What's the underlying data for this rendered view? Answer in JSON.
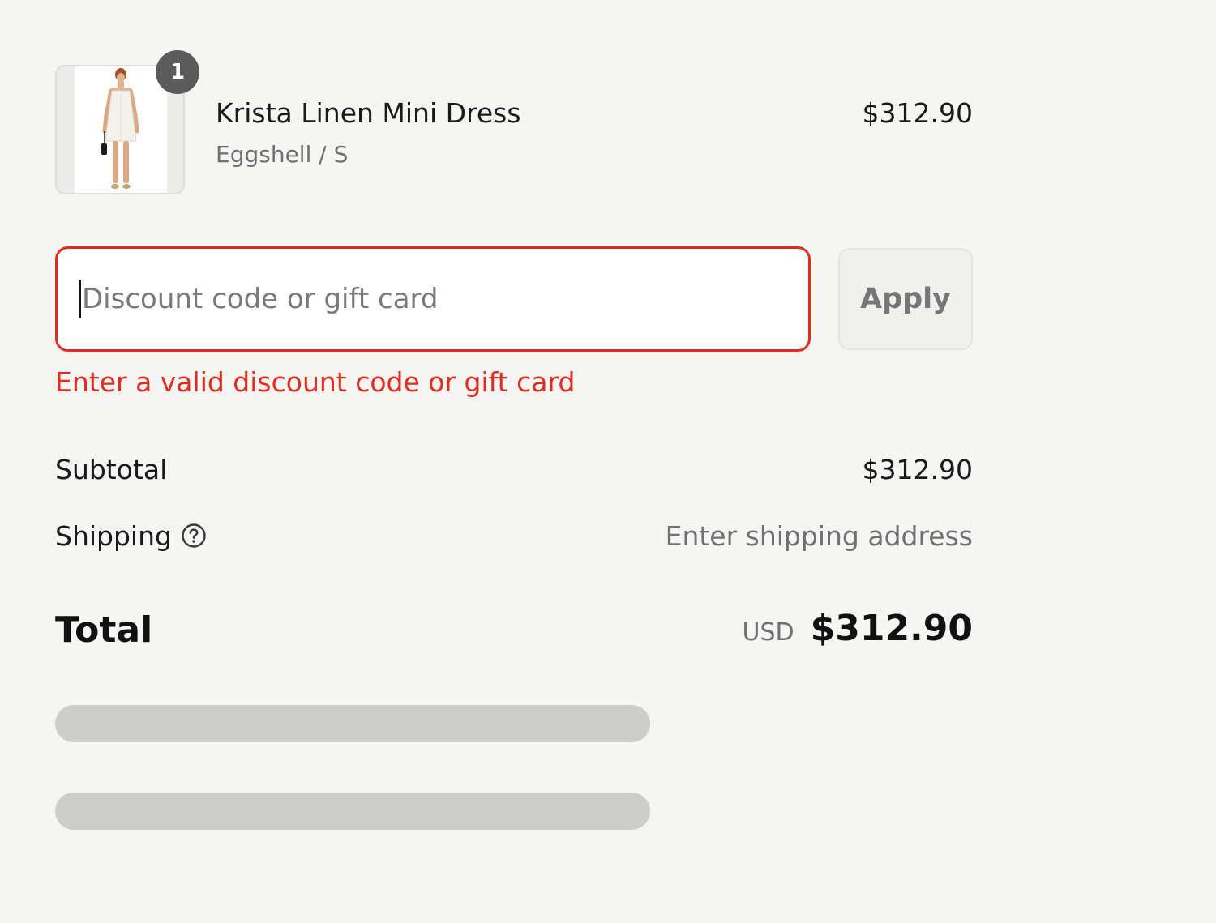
{
  "product": {
    "quantity": "1",
    "name": "Krista Linen Mini Dress",
    "variant": "Eggshell / S",
    "price": "$312.90",
    "image_icon": "dress-product-photo"
  },
  "discount": {
    "placeholder": "Discount code or gift card",
    "value": "",
    "apply_label": "Apply",
    "error": "Enter a valid discount code or gift card"
  },
  "totals": {
    "subtotal_label": "Subtotal",
    "subtotal_value": "$312.90",
    "shipping_label": "Shipping",
    "shipping_help_icon": "question-circle-icon",
    "shipping_value": "Enter shipping address",
    "total_label": "Total",
    "currency": "USD",
    "total_value": "$312.90"
  },
  "colors": {
    "error": "#e32c1e",
    "background": "#f5f5f3",
    "badge": "#5b5b5b",
    "skeleton": "#cdcdcb"
  }
}
